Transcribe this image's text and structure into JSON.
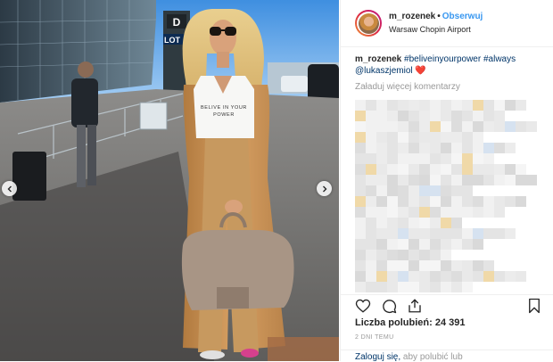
{
  "post": {
    "username": "m_rozenek",
    "follow_label": "Obserwuj",
    "separator": "•",
    "location": "Warsaw Chopin Airport",
    "caption": {
      "username": "m_rozenek",
      "tags": [
        "#beliveinyourpower",
        "#always"
      ],
      "mention": "@lukaszjemiol",
      "emoji": "❤️"
    },
    "load_comments_label": "Załaduj więcej komentarzy",
    "likes_label": "Liczba polubień:",
    "likes_count": "24 391",
    "timestamp": "2 DNI TEMU",
    "login_link": "Zaloguj się,",
    "login_text": " aby polubić lub"
  },
  "photo": {
    "tshirt_text_line1": "BELIVE IN YOUR",
    "tshirt_text_line2": "POWER",
    "sign_letter": "D",
    "sign_brand": "LOT"
  },
  "icons": {
    "like": "heart-icon",
    "comment": "comment-icon",
    "share": "share-icon",
    "save": "bookmark-icon",
    "prev": "chevron-left-icon",
    "next": "chevron-right-icon"
  },
  "colors": {
    "link": "#3897f0",
    "hashtag": "#003569",
    "heart": "#ed4956",
    "muted": "#999999",
    "text": "#262626"
  }
}
